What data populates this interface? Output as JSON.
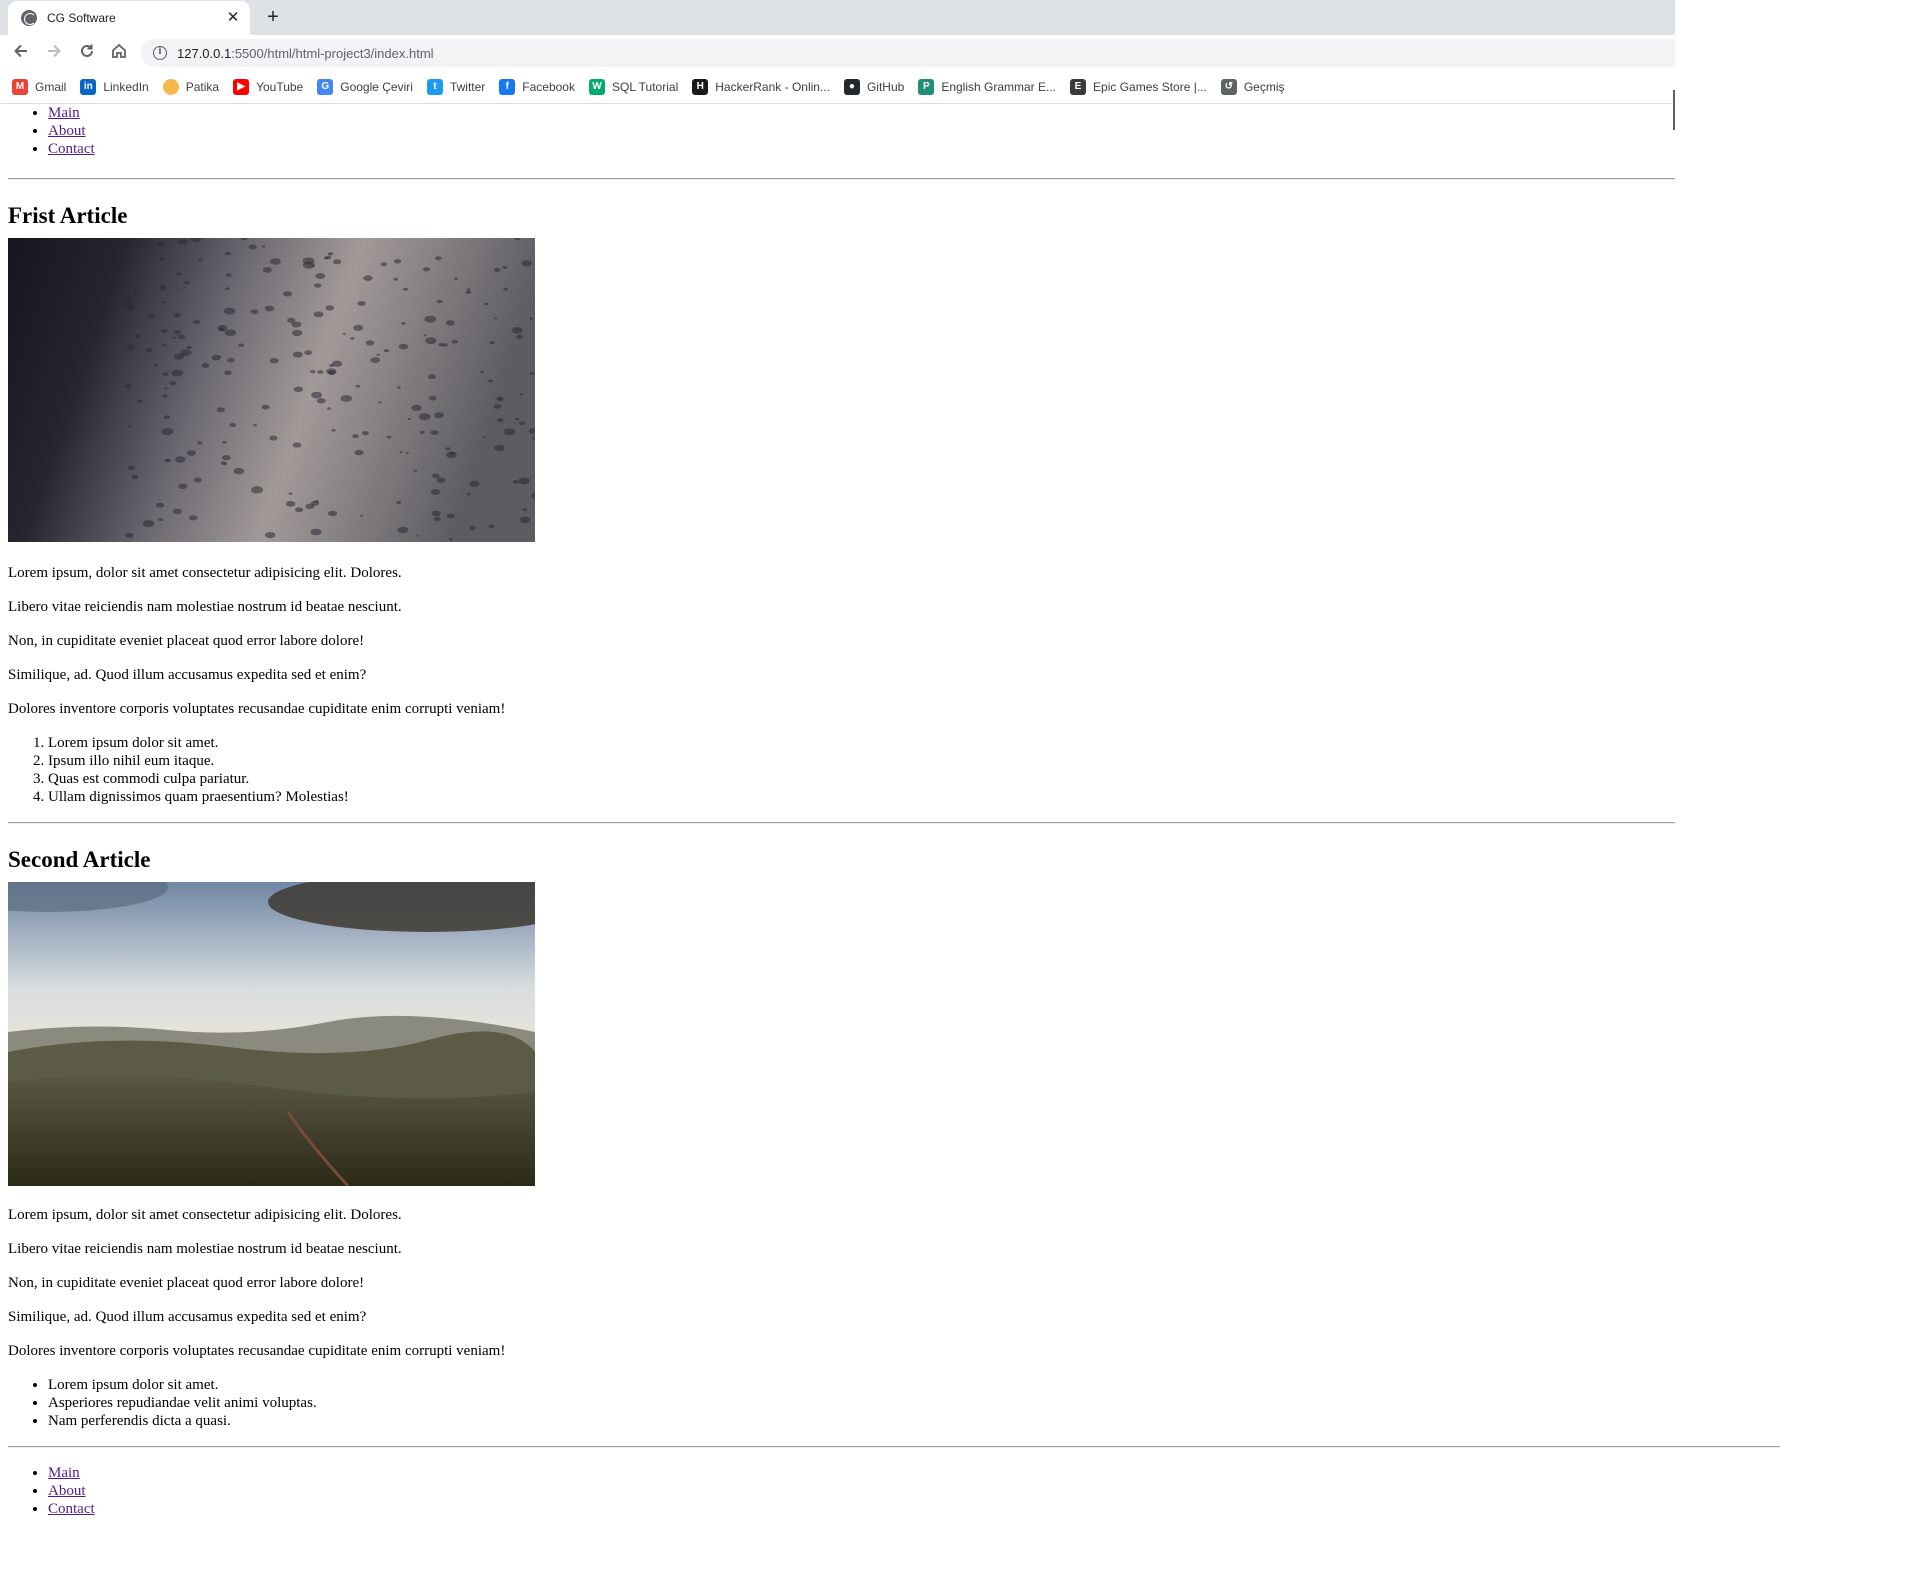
{
  "browser": {
    "tab_title": "CG Software",
    "tab_close": "✕",
    "new_tab": "+",
    "url_host": "127.0.0.1",
    "url_path": ":5500/html/html-project3/index.html",
    "bookmarks": [
      {
        "label": "Gmail",
        "icon": "gmail-icon",
        "glyph": "M",
        "color": "#ea4335"
      },
      {
        "label": "LinkedIn",
        "icon": "linkedin-icon",
        "glyph": "in",
        "color": "#0a66c2"
      },
      {
        "label": "Patika",
        "icon": "patika-icon",
        "glyph": "",
        "color": "#f5b84a"
      },
      {
        "label": "YouTube",
        "icon": "youtube-icon",
        "glyph": "▶",
        "color": "#ff0000"
      },
      {
        "label": "Google Çeviri",
        "icon": "google-translate-icon",
        "glyph": "G",
        "color": "#4285f4"
      },
      {
        "label": "Twitter",
        "icon": "twitter-icon",
        "glyph": "t",
        "color": "#1d9bf0"
      },
      {
        "label": "Facebook",
        "icon": "facebook-icon",
        "glyph": "f",
        "color": "#1877f2"
      },
      {
        "label": "SQL Tutorial",
        "icon": "w3schools-icon",
        "glyph": "W",
        "color": "#04aa6d"
      },
      {
        "label": "HackerRank - Onlin...",
        "icon": "hackerrank-icon",
        "glyph": "H",
        "color": "#1a1a1a"
      },
      {
        "label": "GitHub",
        "icon": "github-icon",
        "glyph": "●",
        "color": "#24292f"
      },
      {
        "label": "English Grammar E...",
        "icon": "grammar-icon",
        "glyph": "P",
        "color": "#1f8f7a"
      },
      {
        "label": "Epic Games Store |...",
        "icon": "epic-games-icon",
        "glyph": "E",
        "color": "#3a3a3a"
      },
      {
        "label": "Geçmiş",
        "icon": "history-icon",
        "glyph": "↺",
        "color": "#5f6368"
      }
    ]
  },
  "nav": [
    "Main",
    "About",
    "Contact"
  ],
  "articles": [
    {
      "title": "Frist Article",
      "image": "wet-surface-photo",
      "paragraphs": [
        "Lorem ipsum, dolor sit amet consectetur adipisicing elit. Dolores.",
        "Libero vitae reiciendis nam molestiae nostrum id beatae nesciunt.",
        "Non, in cupiditate eveniet placeat quod error labore dolore!",
        "Similique, ad. Quod illum accusamus expedita sed et enim?",
        "Dolores inventore corporis voluptates recusandae cupiditate enim corrupti veniam!"
      ],
      "list_type": "ordered",
      "list": [
        "Lorem ipsum dolor sit amet.",
        "Ipsum illo nihil eum itaque.",
        "Quas est commodi culpa pariatur.",
        "Ullam dignissimos quam praesentium? Molestias!"
      ]
    },
    {
      "title": "Second Article",
      "image": "mountain-landscape-photo",
      "paragraphs": [
        "Lorem ipsum, dolor sit amet consectetur adipisicing elit. Dolores.",
        "Libero vitae reiciendis nam molestiae nostrum id beatae nesciunt.",
        "Non, in cupiditate eveniet placeat quod error labore dolore!",
        "Similique, ad. Quod illum accusamus expedita sed et enim?",
        "Dolores inventore corporis voluptates recusandae cupiditate enim corrupti veniam!"
      ],
      "list_type": "unordered",
      "list": [
        "Lorem ipsum dolor sit amet.",
        "Asperiores repudiandae velit animi voluptas.",
        "Nam perferendis dicta a quasi."
      ]
    }
  ],
  "footer_nav": [
    "Main",
    "About",
    "Contact"
  ]
}
